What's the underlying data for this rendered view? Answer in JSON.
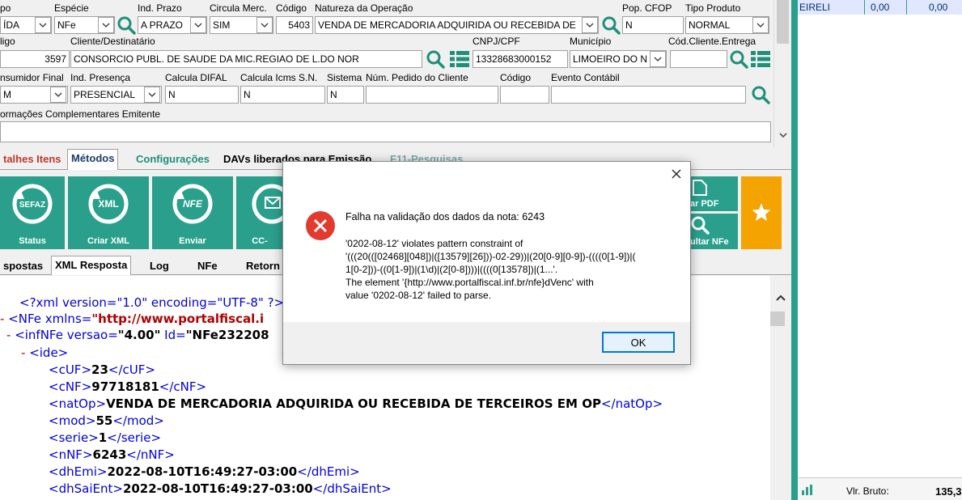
{
  "form": {
    "row1": {
      "labels": {
        "tipo": "po",
        "especie": "Espécie",
        "ind_prazo": "Ind. Prazo",
        "circula": "Circula Merc.",
        "codigo": "Código",
        "natureza": "Natureza da Operação",
        "pop_cfop": "Pop. CFOP",
        "tipo_produto": "Tipo Produto"
      },
      "values": {
        "tipo": "ÍDA",
        "especie": "NFe",
        "ind_prazo": "A PRAZO",
        "circula": "SIM",
        "codigo": "5403",
        "natureza": "VENDA DE MERCADORIA ADQUIRIDA OU RECEBIDA DE",
        "pop_cfop": "N",
        "tipo_produto": "NORMAL"
      }
    },
    "row2": {
      "labels": {
        "codigo": "ligo",
        "cliente": "Cliente/Destinatário",
        "cnpj": "CNPJ/CPF",
        "municipio": "Município",
        "cod_cliente": "Cód.Cliente.Entrega"
      },
      "values": {
        "codigo": "3597",
        "cliente": "CONSORCIO PUBL. DE SAUDE DA MIC.REGIAO DE L.DO NOR",
        "cnpj": "13328683000152",
        "municipio": "LIMOEIRO DO N",
        "cod_cliente": ""
      }
    },
    "row3": {
      "labels": {
        "consumidor": "nsumidor Final",
        "presenca": "Ind. Presença",
        "difal": "Calcula DIFAL",
        "icms": "Calcula Icms S.N.",
        "sistema": "Sistema",
        "pedido": "Núm. Pedido do Cliente",
        "codigo": "Código",
        "evento": "Evento Contábil"
      },
      "values": {
        "consumidor": "M",
        "presenca": "PRESENCIAL",
        "difal": "N",
        "icms": "N",
        "sistema": "N",
        "pedido": "",
        "codigo": "",
        "evento": ""
      }
    },
    "info_label": "ormações Complementares Emitente"
  },
  "tabs1": [
    "talhes Itens",
    "Métodos",
    "Configurações",
    "DAVs liberados para Emissão",
    "F11-Pesquisas"
  ],
  "tiles": [
    {
      "icon": "SEFAZ",
      "label": "Status"
    },
    {
      "icon": "XML",
      "label": "Criar XML"
    },
    {
      "icon": "NFE",
      "label": "Enviar"
    },
    {
      "icon": "",
      "label": "CC-"
    }
  ],
  "tiles_right": {
    "pdf": "ar PDF",
    "consultar": "ultar NFe"
  },
  "tabs2": [
    "spostas",
    "XML Resposta",
    "Log",
    "NFe",
    "Retorn"
  ],
  "xml": {
    "line1": "<?xml version=\"1.0\" encoding=\"UTF-8\" ?>",
    "nfe_tag": "<NFe xmlns=",
    "nfe_ns": "\"http://www.portalfiscal.i",
    "infnfe_tag": "<infNFe versao=",
    "infnfe_ver": "\"4.00\"",
    "infnfe_id": " Id=",
    "infnfe_idval": "\"NFe232208",
    "ide": "<ide>",
    "lines": [
      {
        "tag": "cUF",
        "val": "23"
      },
      {
        "tag": "cNF",
        "val": "97718181"
      },
      {
        "tag": "natOp",
        "val": "VENDA DE MERCADORIA ADQUIRIDA OU RECEBIDA DE TERCEIROS EM OP"
      },
      {
        "tag": "mod",
        "val": "55"
      },
      {
        "tag": "serie",
        "val": "1"
      },
      {
        "tag": "nNF",
        "val": "6243"
      },
      {
        "tag": "dhEmi",
        "val": "2022-08-10T16:49:27-03:00"
      },
      {
        "tag": "dhSaiEnt",
        "val": "2022-08-10T16:49:27-03:00"
      }
    ]
  },
  "right_panel": {
    "row": {
      "name": "EIRELI",
      "v1": "0,00",
      "v2": "0,00"
    },
    "footer_label": "Vlr. Bruto:",
    "footer_value": "135,3"
  },
  "dialog": {
    "title": "Falha na validação dos dados da nota: 6243",
    "line1": "'0202-08-12' violates pattern constraint of",
    "line2": "'(((20(([02468][048])|([13579][26]))-02-29))|(20[0-9][0-9])-((((0[1-9])|(",
    "line3": "1[0-2]))-((0[1-9])|(1\\d)|(2[0-8])))|((((0[13578])|(1...'.",
    "line4": "The element '{http://www.portalfiscal.inf.br/nfe}dVenc' with",
    "line5": "value '0202-08-12' failed to parse.",
    "ok": "OK"
  },
  "colors": {
    "teal": "#2aa08c",
    "orange": "#f5a300",
    "error_red": "#e23b2e",
    "xml_blue": "#0000e0",
    "xml_red": "#b00000"
  }
}
